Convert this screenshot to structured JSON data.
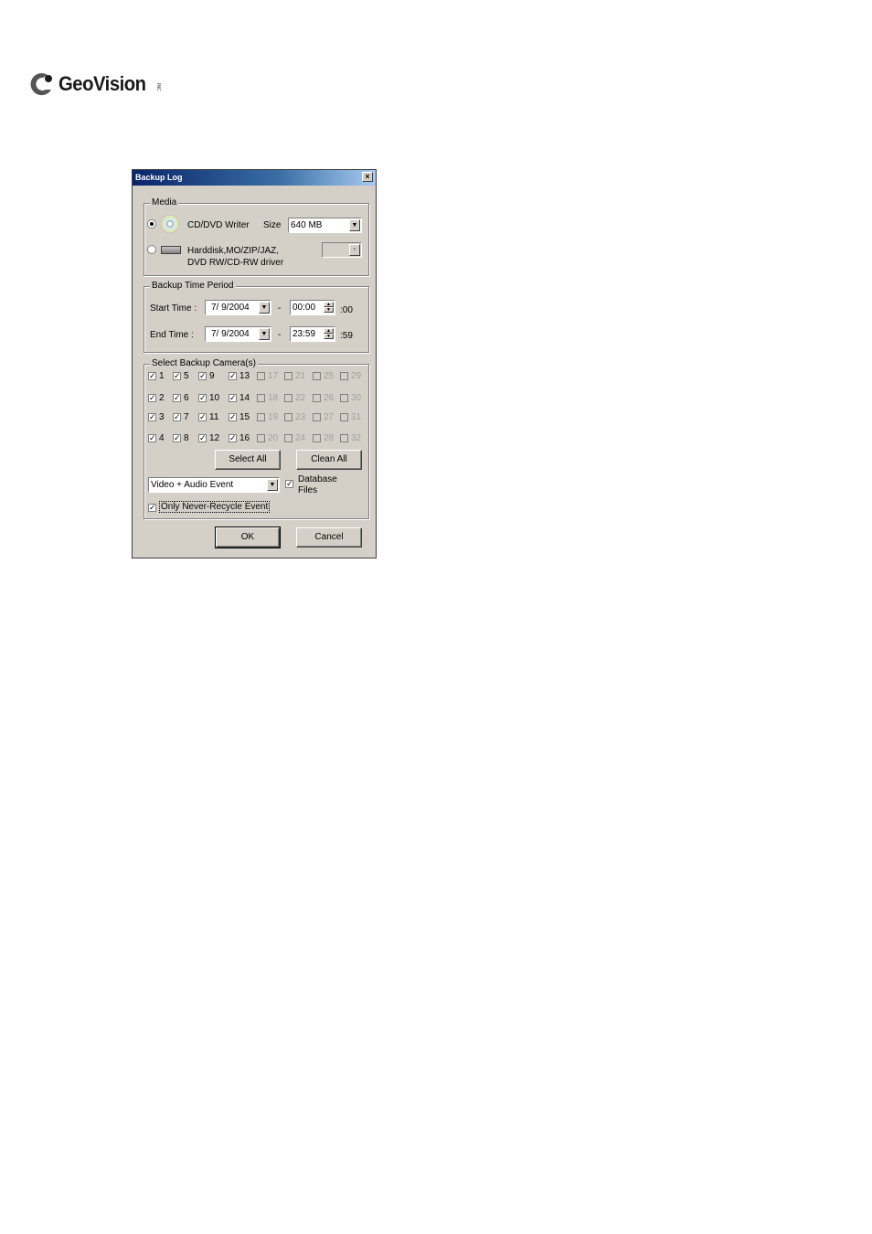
{
  "logo": {
    "text": "GeoVision",
    "tm": "INC"
  },
  "dialog": {
    "title": "Backup Log",
    "close_glyph": "×",
    "media": {
      "label": "Media",
      "cd_dvd": {
        "label": "CD/DVD Writer",
        "selected": true
      },
      "size_label": "Size",
      "size_value": "640 MB",
      "harddisk": {
        "label_line1": "Harddisk,MO/ZIP/JAZ,",
        "label_line2": "DVD RW/CD-RW driver",
        "selected": false
      },
      "drive_value": ""
    },
    "period": {
      "label": "Backup Time Period",
      "start_label": "Start Time :",
      "start_date": "7/ 9/2004",
      "start_time": "00:00",
      "start_sec": ":00",
      "end_label": "End Time :",
      "end_date": "7/ 9/2004",
      "end_time": "23:59",
      "end_sec": ":59",
      "dash": "-"
    },
    "cameras": {
      "label": "Select Backup Camera(s)",
      "select_all": "Select All",
      "clean_all": "Clean All",
      "event_type": "Video + Audio Event",
      "database_line1": "Database",
      "database_line2": "Files",
      "database_checked": true,
      "never_recycle": "Only Never-Recycle Event",
      "never_recycle_checked": true,
      "items": [
        {
          "n": "1",
          "checked": true,
          "enabled": true
        },
        {
          "n": "5",
          "checked": true,
          "enabled": true
        },
        {
          "n": "9",
          "checked": true,
          "enabled": true
        },
        {
          "n": "13",
          "checked": true,
          "enabled": true
        },
        {
          "n": "17",
          "checked": false,
          "enabled": false
        },
        {
          "n": "21",
          "checked": false,
          "enabled": false
        },
        {
          "n": "25",
          "checked": false,
          "enabled": false
        },
        {
          "n": "29",
          "checked": false,
          "enabled": false
        },
        {
          "n": "2",
          "checked": true,
          "enabled": true
        },
        {
          "n": "6",
          "checked": true,
          "enabled": true
        },
        {
          "n": "10",
          "checked": true,
          "enabled": true
        },
        {
          "n": "14",
          "checked": true,
          "enabled": true
        },
        {
          "n": "18",
          "checked": false,
          "enabled": false
        },
        {
          "n": "22",
          "checked": false,
          "enabled": false
        },
        {
          "n": "26",
          "checked": false,
          "enabled": false
        },
        {
          "n": "30",
          "checked": false,
          "enabled": false
        },
        {
          "n": "3",
          "checked": true,
          "enabled": true
        },
        {
          "n": "7",
          "checked": true,
          "enabled": true
        },
        {
          "n": "11",
          "checked": true,
          "enabled": true
        },
        {
          "n": "15",
          "checked": true,
          "enabled": true
        },
        {
          "n": "19",
          "checked": false,
          "enabled": false
        },
        {
          "n": "23",
          "checked": false,
          "enabled": false
        },
        {
          "n": "27",
          "checked": false,
          "enabled": false
        },
        {
          "n": "31",
          "checked": false,
          "enabled": false
        },
        {
          "n": "4",
          "checked": true,
          "enabled": true
        },
        {
          "n": "8",
          "checked": true,
          "enabled": true
        },
        {
          "n": "12",
          "checked": true,
          "enabled": true
        },
        {
          "n": "16",
          "checked": true,
          "enabled": true
        },
        {
          "n": "20",
          "checked": false,
          "enabled": false
        },
        {
          "n": "24",
          "checked": false,
          "enabled": false
        },
        {
          "n": "28",
          "checked": false,
          "enabled": false
        },
        {
          "n": "32",
          "checked": false,
          "enabled": false
        }
      ]
    },
    "ok": "OK",
    "cancel": "Cancel",
    "check_glyph": "✓"
  }
}
